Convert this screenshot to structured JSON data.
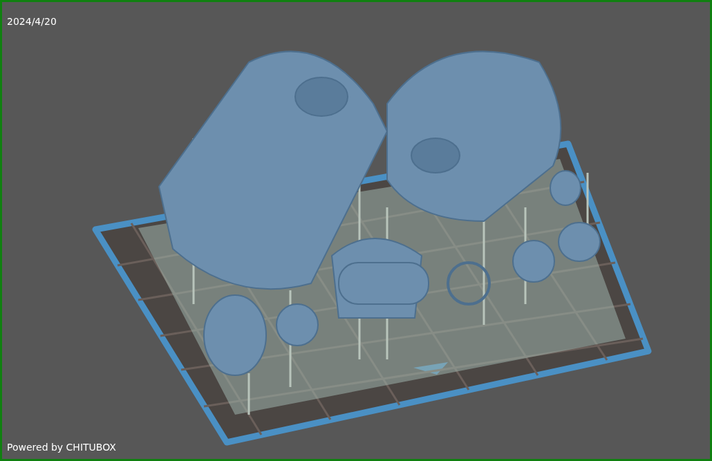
{
  "viewport": {
    "date": "2024/4/20",
    "branding": "Powered by CHITUBOX"
  }
}
